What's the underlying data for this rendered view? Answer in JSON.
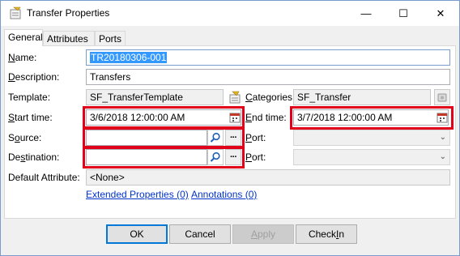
{
  "window": {
    "title": "Transfer Properties",
    "minimize_glyph": "—",
    "maximize_glyph": "☐",
    "close_glyph": "✕"
  },
  "tabs": [
    {
      "label": "General",
      "active": true
    },
    {
      "label": "Attributes",
      "active": false
    },
    {
      "label": "Ports",
      "active": false
    }
  ],
  "form": {
    "name_label": "Name:",
    "name_value": "TR20180306-001",
    "description_label": "Description:",
    "description_value": "Transfers",
    "template_label": "Template:",
    "template_value": "SF_TransferTemplate",
    "categories_label": "Categories:",
    "categories_value": "SF_Transfer",
    "start_time_label": "Start time:",
    "start_time_value": "3/6/2018 12:00:00 AM",
    "end_time_label": "End time:",
    "end_time_value": "3/7/2018 12:00:00 AM",
    "source_label": "Source:",
    "source_value": "",
    "source_port_label": "Port:",
    "destination_label": "Destination:",
    "destination_value": "",
    "destination_port_label": "Port:",
    "default_attribute_label": "Default Attribute:",
    "default_attribute_value": "<None>"
  },
  "links": {
    "extended_properties": "Extended Properties (0)",
    "annotations": "Annotations (0)"
  },
  "buttons": {
    "ok": "OK",
    "cancel": "Cancel",
    "apply": "Apply",
    "check_in": "Check In"
  },
  "icons": {
    "title": "properties-icon",
    "template_browse": "template-icon",
    "categories_browse": "category-icon",
    "calendar": "calendar-icon",
    "search": "search-icon",
    "more": "ellipsis-icon",
    "dropdown": "chevron-down-icon"
  },
  "colors": {
    "highlight_box": "#e0001a",
    "selection": "#3399ff",
    "link": "#0033cc",
    "default_button_border": "#0078d7"
  }
}
